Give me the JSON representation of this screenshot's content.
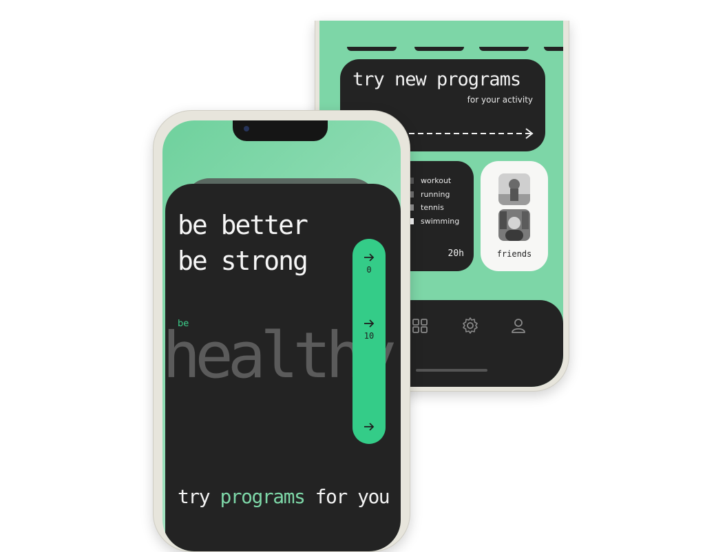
{
  "colors": {
    "accent": "#34cc88",
    "mint": "#7dd6a7",
    "dark": "#232323",
    "light": "#f7f7f5"
  },
  "back_phone": {
    "programs_card": {
      "title": "try new programs",
      "subtitle": "for your activity",
      "icon": "long-dashed-arrow-right-icon"
    },
    "activity": {
      "items": [
        {
          "label": "workout",
          "color": "#555555"
        },
        {
          "label": "running",
          "color": "#6f6f6f"
        },
        {
          "label": "tennis",
          "color": "#8d8d8d"
        },
        {
          "label": "swimming",
          "color": "#f4f4f4"
        }
      ],
      "total": "20h"
    },
    "friends": {
      "label": "friends"
    },
    "nav": {
      "icons": [
        "grid-icon",
        "gear-icon",
        "user-icon"
      ]
    }
  },
  "front_phone": {
    "headline_1": "be better",
    "headline_2": "be strong",
    "small_label": "be",
    "big_word": "healthy",
    "slider": {
      "marker_1": "0",
      "marker_2": "10",
      "icon": "arrow-right-icon"
    },
    "footer": {
      "word_1": "try",
      "word_2": "programs",
      "word_3": "for you"
    }
  }
}
